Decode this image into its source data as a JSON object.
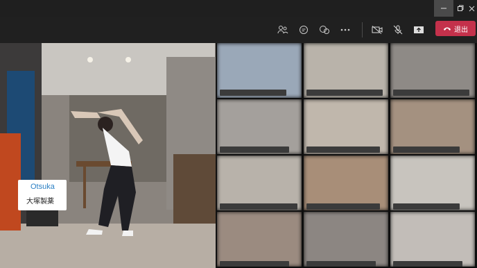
{
  "window": {
    "minimize_icon": "minimize-icon",
    "restore_icon": "restore-icon",
    "close_icon": "close-icon"
  },
  "toolbar": {
    "people_icon": "people-icon",
    "chat_icon": "chat-icon",
    "reactions_icon": "reactions-icon",
    "more_icon": "more-icon",
    "camera_icon": "camera-off-icon",
    "mic_icon": "mic-off-icon",
    "share_icon": "share-icon",
    "leave_label": "退出",
    "leave_color": "#c4314b"
  },
  "speaker": {
    "logo_text": "Otsuka",
    "logo_subtext": "大塚製薬"
  },
  "grid_tiles": [
    {
      "bg": "#9aa8b8"
    },
    {
      "bg": "#b9b3aa"
    },
    {
      "bg": "#8e8a86"
    },
    {
      "bg": "#a4a09c"
    },
    {
      "bg": "#c0b7ac"
    },
    {
      "bg": "#a49180"
    },
    {
      "bg": "#b8b2aa"
    },
    {
      "bg": "#a88e78"
    },
    {
      "bg": "#c8c4be"
    },
    {
      "bg": "#9b8b80"
    },
    {
      "bg": "#8c8682"
    },
    {
      "bg": "#c2bdb8"
    }
  ]
}
